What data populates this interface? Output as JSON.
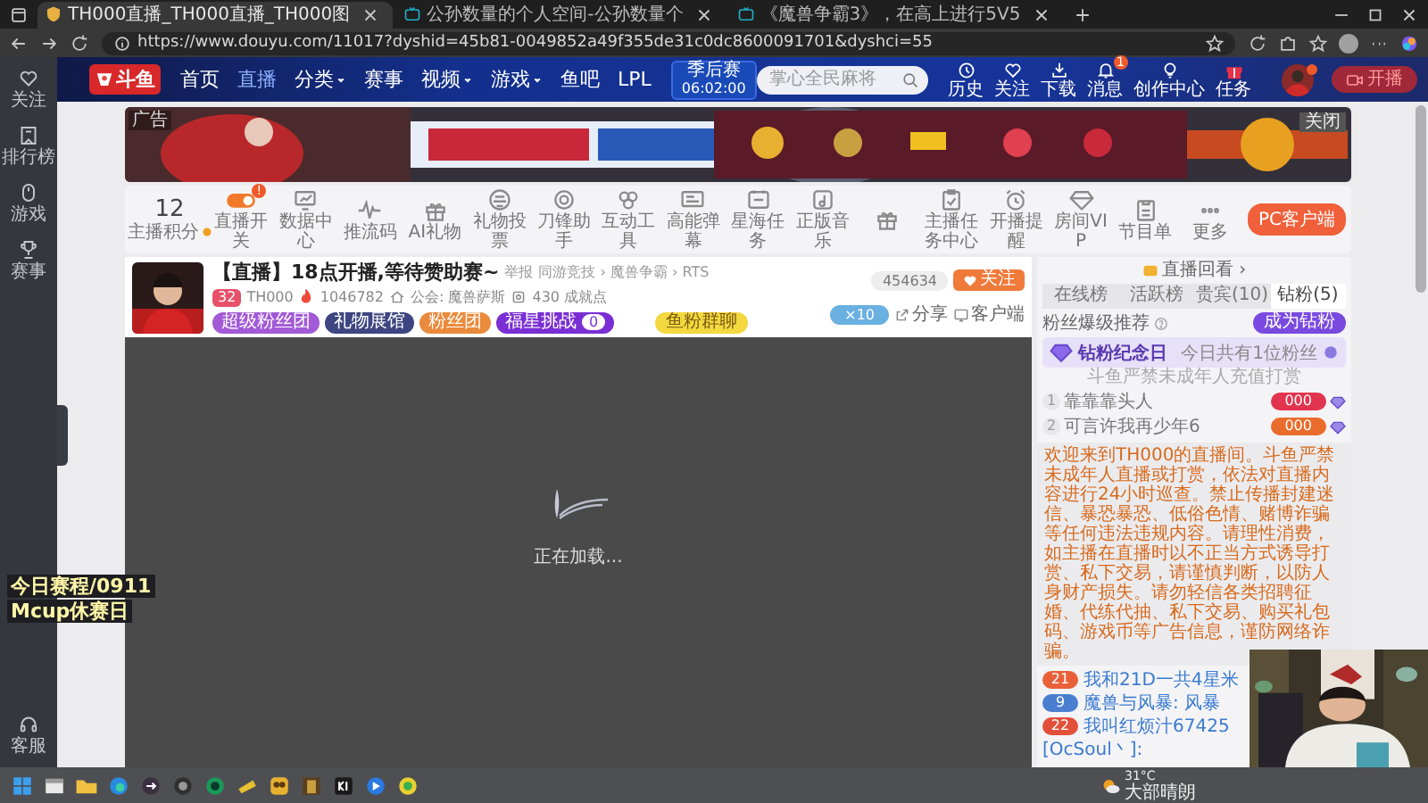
{
  "browser": {
    "tabs": [
      {
        "title": "TH000直播_TH000直播_TH000图",
        "selected": true
      },
      {
        "title": "公孙数量的个人空间-公孙数量个",
        "selected": false
      },
      {
        "title": "《魔兽争霸3》，在高上进行5V5",
        "selected": false
      }
    ],
    "url": "https://www.douyu.com/11017?dyshid=45b81-0049852a49f355de31c0dc8600091701&dyshci=55"
  },
  "sidebar": {
    "items": [
      {
        "label": "关注"
      },
      {
        "label": "排行榜"
      },
      {
        "label": "游戏"
      },
      {
        "label": "赛事"
      }
    ],
    "footer": {
      "label": "客服"
    }
  },
  "topnav": {
    "logo": "斗鱼",
    "items": [
      {
        "label": "首页",
        "selected": false,
        "dropdown": false
      },
      {
        "label": "直播",
        "selected": true,
        "dropdown": false
      },
      {
        "label": "分类",
        "selected": false,
        "dropdown": true
      },
      {
        "label": "赛事",
        "selected": false,
        "dropdown": false
      },
      {
        "label": "视频",
        "selected": false,
        "dropdown": true
      },
      {
        "label": "游戏",
        "selected": false,
        "dropdown": true
      },
      {
        "label": "鱼吧",
        "selected": false,
        "dropdown": false
      },
      {
        "label": "LPL",
        "selected": false,
        "dropdown": false
      }
    ],
    "event": {
      "title": "季后赛",
      "time": "06:02:00"
    },
    "search": {
      "placeholder": "掌心全民麻将"
    },
    "actions": [
      {
        "label": "历史"
      },
      {
        "label": "关注"
      },
      {
        "label": "下载"
      },
      {
        "label": "消息",
        "badge": "1"
      },
      {
        "label": "创作中心"
      },
      {
        "label": "任务"
      }
    ],
    "go_live": "开播"
  },
  "banner": {
    "kind": "picture",
    "ad_label": "广告",
    "close": "关闭"
  },
  "toolbar": {
    "score": {
      "value": "12",
      "label": "主播积分"
    },
    "items": [
      {
        "kind": "toggle",
        "label": "直播开关",
        "on": true,
        "badge": "!"
      },
      {
        "kind": "tool",
        "label": "数据中心"
      },
      {
        "kind": "tool",
        "label": "推流码"
      },
      {
        "kind": "tool",
        "label": "AI礼物"
      },
      {
        "kind": "tool",
        "label": "礼物投票"
      },
      {
        "kind": "tool",
        "label": "刀锋助手"
      },
      {
        "kind": "tool",
        "label": "互动工具"
      },
      {
        "kind": "tool",
        "label": "高能弹幕"
      },
      {
        "kind": "tool",
        "label": "星海任务"
      },
      {
        "kind": "tool",
        "label": "正版音乐"
      },
      {
        "kind": "tool"
      },
      {
        "kind": "tool",
        "label": "主播任务中心"
      },
      {
        "kind": "tool",
        "label": "开播提醒"
      },
      {
        "kind": "tool",
        "label": "房间VIP"
      },
      {
        "kind": "tool",
        "label": "节目单"
      },
      {
        "kind": "tool",
        "label": "更多"
      }
    ],
    "client_button": "PC客户端"
  },
  "stream": {
    "title": "【直播】18点开播,等待赞助赛~",
    "report": "举报",
    "category": "同游竞技 › 魔兽争霸 › RTS",
    "level": "32",
    "streamer": "TH000",
    "heat": "1046782",
    "guild": "公会: 魔兽萨斯",
    "achievement": "430 成就点",
    "badges": [
      {
        "label": "超级粉丝团",
        "color": "#a25ad6"
      },
      {
        "label": "礼物展馆",
        "color": "#3d4680"
      },
      {
        "label": "粉丝团",
        "color": "#ea8a3c"
      },
      {
        "label": "福星挑战",
        "color": "#7a2fd4",
        "count": "0"
      }
    ],
    "fan_group": "鱼粉群聊",
    "followers": "454634",
    "follow": "关注",
    "fan_level": "×10",
    "share": "分享",
    "client": "客户端"
  },
  "player": {
    "loading": "正在加载..."
  },
  "panel": {
    "replay": "直播回看 ›",
    "tabs": [
      {
        "label": "在线榜",
        "selected": false
      },
      {
        "label": "活跃榜",
        "selected": false
      },
      {
        "label": "贵宾(10)",
        "selected": false
      },
      {
        "label": "钻粉(5)",
        "selected": true
      }
    ],
    "recommend": "粉丝爆级推荐",
    "become": "成为钻粉",
    "anniversary": {
      "title": "钻粉纪念日",
      "note": "今日共有1位粉丝"
    },
    "warning": "斗鱼严禁未成年人充值打赏",
    "ranks": [
      {
        "rank": "1",
        "name": "靠靠靠头人",
        "badge": "000",
        "color": "#e2344e"
      },
      {
        "rank": "2",
        "name": "可言许我再少年6",
        "badge": "000",
        "color": "#ea6c2c"
      }
    ],
    "notice": "欢迎来到TH000的直播间。斗鱼严禁未成年人直播或打赏，依法对直播内容进行24小时巡查。禁止传播封建迷信、暴恐暴恐、低俗色情、赌博诈骗等任何违法违规内容。请理性消费，如主播在直播时以不正当方式诱导打赏、私下交易，请谨慎判断，以防人身财产损失。请勿轻信各类招聘征婚、代练代抽、私下交易、购买礼包码、游戏币等广告信息，谨防网络诈骗。",
    "chat": [
      {
        "kind": "message",
        "level": "21",
        "color": "#e8603a",
        "text": "我和21D一共4星米"
      },
      {
        "kind": "message",
        "level": "9",
        "color": "#4a7fd0",
        "text": "魔兽与风暴: 风暴"
      },
      {
        "kind": "message",
        "level": "22",
        "color": "#e2503a",
        "text": "我叫红烦汁67425"
      },
      {
        "kind": "entry",
        "text": "[OcSoul丶]:"
      }
    ]
  },
  "overlay": {
    "lines": [
      "今日赛程/0911",
      "Mcup休赛日"
    ]
  },
  "taskbar": {
    "weather": {
      "temp": "31°C",
      "condition": "大部晴朗"
    }
  }
}
